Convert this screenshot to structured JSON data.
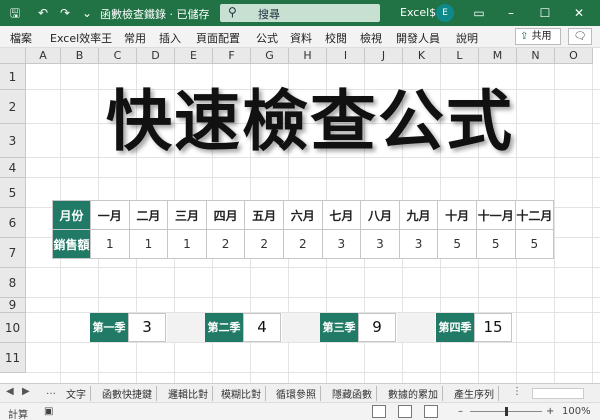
{
  "titlebar": {
    "doc_title": "函數檢查鐵錄 · 已儲存",
    "search_placeholder": "搜尋",
    "user_name": "Excel$",
    "avatar_initial": "E"
  },
  "ribbon": {
    "tabs": [
      "檔案",
      "Excel效率王",
      "常用",
      "插入",
      "頁面配置",
      "公式",
      "資料",
      "校閱",
      "檢視",
      "開發人員",
      "說明"
    ],
    "share_label": "共用"
  },
  "sheet": {
    "columns": [
      "A",
      "B",
      "C",
      "D",
      "E",
      "F",
      "G",
      "H",
      "I",
      "J",
      "K",
      "L",
      "M",
      "N",
      "O"
    ],
    "rows": [
      "1",
      "2",
      "3",
      "4",
      "5",
      "6",
      "7",
      "8",
      "9",
      "10",
      "11"
    ],
    "title": "快速檢查公式",
    "table": {
      "month_header": "月份",
      "sales_header": "銷售額",
      "months": [
        "一月",
        "二月",
        "三月",
        "四月",
        "五月",
        "六月",
        "七月",
        "八月",
        "九月",
        "十月",
        "十一月",
        "十二月"
      ],
      "sales": [
        "1",
        "1",
        "1",
        "2",
        "2",
        "2",
        "3",
        "3",
        "3",
        "5",
        "5",
        "5"
      ]
    },
    "quarters": [
      {
        "label": "第一季",
        "value": "3"
      },
      {
        "label": "第二季",
        "value": "4"
      },
      {
        "label": "第三季",
        "value": "9"
      },
      {
        "label": "第四季",
        "value": "15"
      }
    ]
  },
  "sheet_tabs": [
    "文字",
    "函數快捷鍵",
    "邏輯比對",
    "模糊比對",
    "循環參照",
    "隱藏函數",
    "數據的累加",
    "產生序列"
  ],
  "statusbar": {
    "mode": "計算",
    "zoom": "100%"
  },
  "colors": {
    "brand": "#217346",
    "header_fill": "#217a66"
  }
}
